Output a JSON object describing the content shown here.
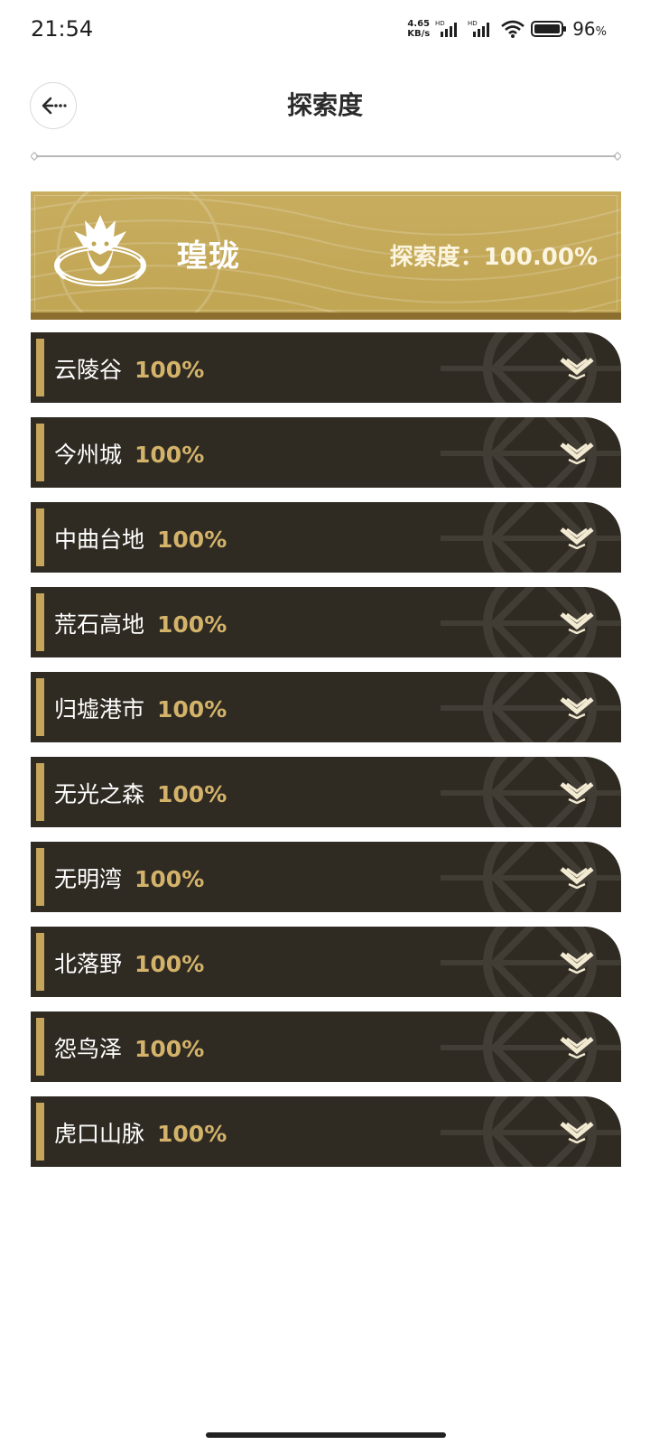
{
  "status_bar": {
    "time": "21:54",
    "net_speed_value": "4.65",
    "net_speed_unit": "KB/s",
    "battery_percent": "96",
    "percent_sign": "%"
  },
  "header": {
    "title": "探索度"
  },
  "region": {
    "name": "瑝珑",
    "progress_text": "探索度：100.00%"
  },
  "areas": [
    {
      "name": "云陵谷",
      "percent": "100%"
    },
    {
      "name": "今州城",
      "percent": "100%"
    },
    {
      "name": "中曲台地",
      "percent": "100%"
    },
    {
      "name": "荒石高地",
      "percent": "100%"
    },
    {
      "name": "归墟港市",
      "percent": "100%"
    },
    {
      "name": "无光之森",
      "percent": "100%"
    },
    {
      "name": "无明湾",
      "percent": "100%"
    },
    {
      "name": "北落野",
      "percent": "100%"
    },
    {
      "name": "怨鸟泽",
      "percent": "100%"
    },
    {
      "name": "虎口山脉",
      "percent": "100%"
    }
  ],
  "colors": {
    "banner_gold": "#c8ad5f",
    "item_dark": "#2f2a22",
    "accent_gold": "#c4a55b",
    "percent_gold": "#d3b36a"
  },
  "icons": {
    "back": "back-arrow-icon",
    "emblem": "dragon-emblem-icon",
    "expand": "chevron-down-icon"
  }
}
